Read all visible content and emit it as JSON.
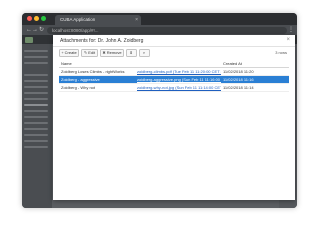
{
  "browser": {
    "tab_title": "CUBA Application",
    "address": "localhost:8080/app/#!...",
    "back_icon": "back-arrow-icon",
    "forward_icon": "forward-arrow-icon",
    "reload_icon": "reload-icon",
    "menu_icon": "more-vert-icon"
  },
  "dialog": {
    "title": "Attachments for: Dr. John A. Zoidberg",
    "close_icon": "close-icon",
    "buttons": {
      "create": "Create",
      "edit": "Edit",
      "remove": "Remove",
      "download_icon": "download-icon",
      "search_icon": "search-icon"
    },
    "item_count": "3 rows",
    "table": {
      "columns": [
        "Name",
        "",
        "Created At"
      ],
      "rows": [
        {
          "name": "Zoidberg Loses Climbs - rightWorks",
          "file": "zoidberg-climbs.pdf (Tue Feb 11 11:20:00 CET 2018)",
          "created": "11/02/2018 11:20",
          "selected": false
        },
        {
          "name": "Zoidberg - aggressive",
          "file": "zoidberg-aggressive.png (Sun Feb 11 11:16:00 CET 2018)",
          "created": "11/02/2018 11:16",
          "selected": true
        },
        {
          "name": "Zoidberg - Why not",
          "file": "zoidberg-why-not.jpg (Sun Feb 11 11:14:00 CET 2018)",
          "created": "11/02/2018 11:14",
          "selected": false
        }
      ]
    }
  },
  "colors": {
    "selected_row": "#2a7fd4",
    "link": "#1f5fbf",
    "app_background": "#5b5e62"
  }
}
